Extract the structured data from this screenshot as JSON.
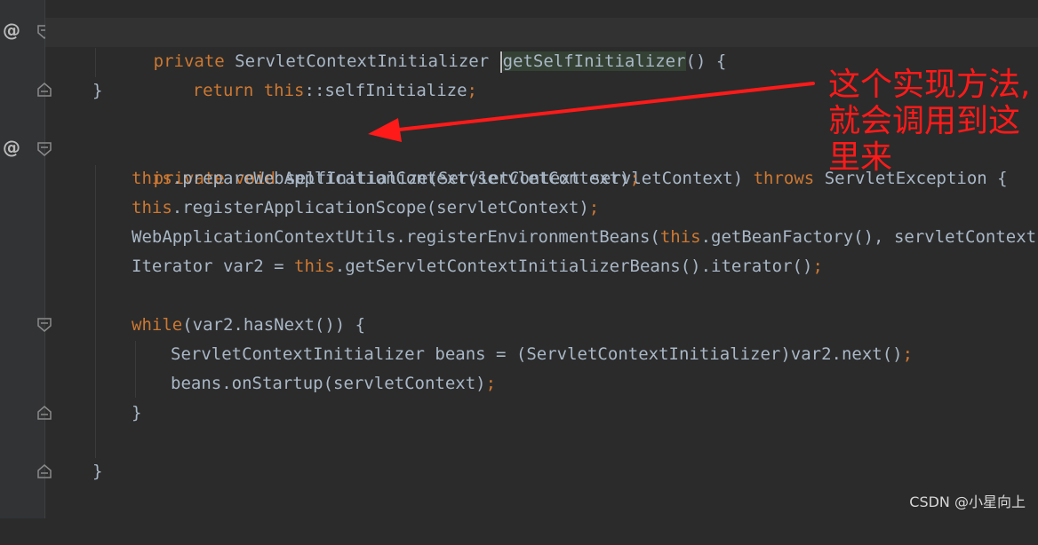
{
  "code": {
    "line1": {
      "kw_private": "private",
      "type": "ServletContextInitializer",
      "method": "getSelfInitializer",
      "rest": "() {"
    },
    "line2": {
      "kw_return": "return",
      "kw_this": "this",
      "rest": "::selfInitialize",
      "semi": ";"
    },
    "line3": {
      "brace": "}"
    },
    "line5": {
      "kw_private": "private",
      "kw_void": "void",
      "sig": "selfInitialize(ServletContext servletContext)",
      "kw_throws": "throws",
      "exc": "ServletException {"
    },
    "line6": {
      "kw_this": "this",
      "rest": ".prepareWebApplicationContext(servletContext)",
      "semi": ";"
    },
    "line7": {
      "kw_this": "this",
      "rest": ".registerApplicationScope(servletContext)",
      "semi": ";"
    },
    "line8": {
      "pre": "WebApplicationContextUtils.registerEnvironmentBeans(",
      "kw_this": "this",
      "mid": ".getBeanFactory(),",
      "post": " servletContext)",
      "semi": ";"
    },
    "line9": {
      "pre": "Iterator var2 = ",
      "kw_this": "this",
      "rest": ".getServletContextInitializerBeans().iterator()",
      "semi": ";"
    },
    "line11": {
      "kw_while": "while",
      "rest": "(var2.hasNext()) {"
    },
    "line12": {
      "rest": "ServletContextInitializer beans = (ServletContextInitializer)var2.next()",
      "semi": ";"
    },
    "line13": {
      "rest": "beans.onStartup(servletContext)",
      "semi": ";"
    },
    "line14": {
      "brace": "}"
    },
    "line16": {
      "brace": "}"
    }
  },
  "gutter": {
    "override_marker": "@"
  },
  "annotation": {
    "line1": "这个实现方法,",
    "line2": "就会调用到这",
    "line3": "里来"
  },
  "watermark": "CSDN @小星向上",
  "colors": {
    "background": "#2b2b2b",
    "keyword": "#cc7832",
    "identifier": "#a9b7c6",
    "annotation": "#ff1a1a"
  }
}
